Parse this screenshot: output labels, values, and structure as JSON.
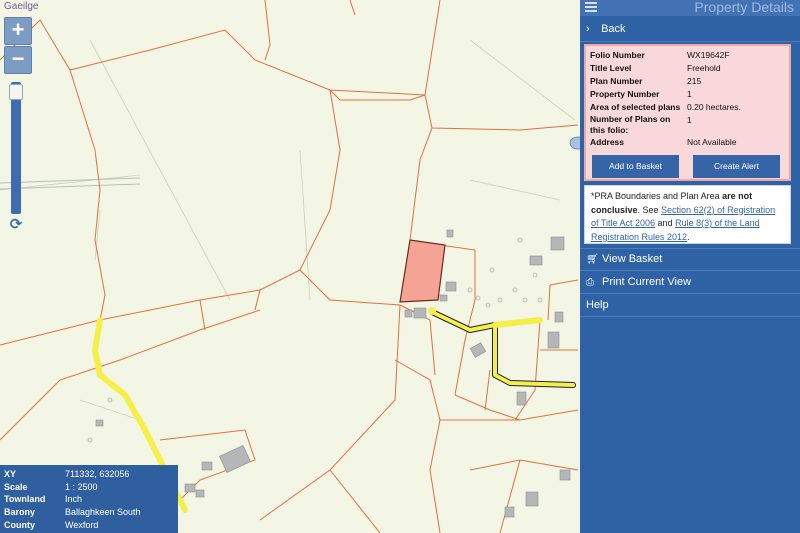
{
  "map": {
    "language_link": "Gaeilge",
    "zoom_in_label": "+",
    "zoom_out_label": "−",
    "refresh_icon": "refresh-icon"
  },
  "info": {
    "rows": [
      {
        "key": "XY",
        "value": "711332, 632056"
      },
      {
        "key": "Scale",
        "value": "1 : 2500"
      },
      {
        "key": "Townland",
        "value": "Inch"
      },
      {
        "key": "Barony",
        "value": "Ballaghkeen South"
      },
      {
        "key": "County",
        "value": "Wexford"
      }
    ]
  },
  "panel": {
    "title": "Property Details",
    "back_label": "Back",
    "property": {
      "rows": [
        {
          "key": "Folio Number",
          "value": "WX19642F"
        },
        {
          "key": "Title Level",
          "value": "Freehold"
        },
        {
          "key": "Plan Number",
          "value": "215"
        },
        {
          "key": "Property Number",
          "value": "1"
        },
        {
          "key": "Area of selected plans",
          "value": "0.20 hectares."
        },
        {
          "key": "Number of Plans on this folio:",
          "value": "1"
        },
        {
          "key": "Address",
          "value": "Not Available"
        }
      ],
      "add_to_basket_label": "Add to Basket",
      "create_alert_label": "Create Alert"
    },
    "notice": {
      "prefix": "*PRA Boundaries and Plan Area ",
      "bold": "are not conclusive",
      "see": ". See ",
      "link1": "Section 62(2) of Registration of Title Act 2006",
      "and": " and ",
      "link2": "Rule 8(3) of the Land Registration Rules 2012",
      "end": "."
    },
    "menu": [
      {
        "icon": "cart-icon",
        "label": "View Basket"
      },
      {
        "icon": "printer-icon",
        "label": "Print Current View"
      },
      {
        "icon": "",
        "label": "Help"
      }
    ]
  },
  "colors": {
    "panel_bg": "#2f62a4",
    "parcel_boundary": "#e0703f",
    "selected_parcel": "#f4a394",
    "road": "#f6ef4a"
  }
}
